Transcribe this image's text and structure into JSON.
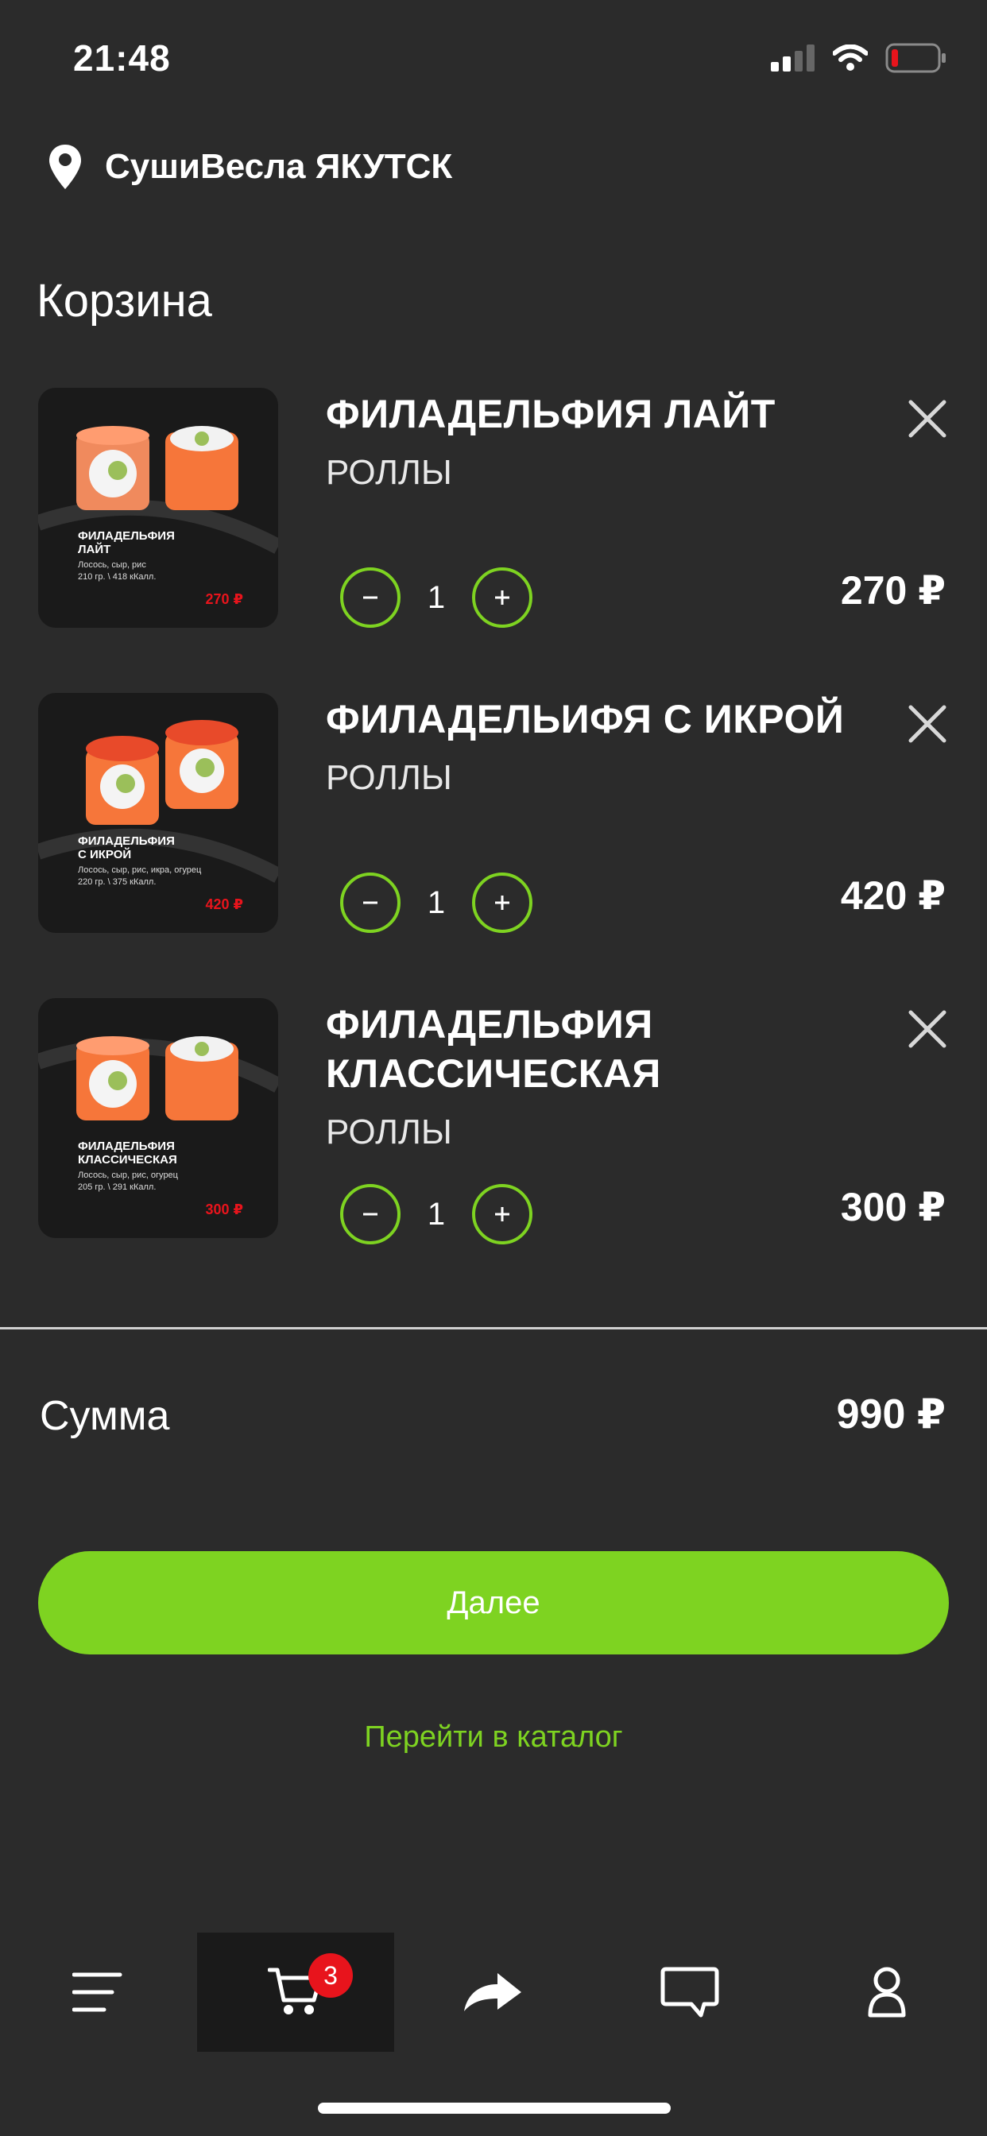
{
  "status_bar": {
    "time": "21:48"
  },
  "header": {
    "location": "СушиВесла ЯКУТСК"
  },
  "page": {
    "title": "Корзина"
  },
  "cart_items": [
    {
      "name_line1": "ФИЛАДЕЛЬФИЯ ЛАЙТ",
      "name_line2": "",
      "category": "РОЛЛЫ",
      "quantity": "1",
      "price": "270 ₽",
      "thumb": {
        "title_line1": "ФИЛАДЕЛЬФИЯ",
        "title_line2": "ЛАЙТ",
        "desc_line1": "Лосось, сыр, рис",
        "desc_line2": "210 гр. \\ 418 кКалл.",
        "price": "270 ₽"
      }
    },
    {
      "name_line1": "ФИЛАДЕЛЬИФЯ С ИКРОЙ",
      "name_line2": "",
      "category": "РОЛЛЫ",
      "quantity": "1",
      "price": "420 ₽",
      "thumb": {
        "title_line1": "ФИЛАДЕЛЬФИЯ",
        "title_line2": "С ИКРОЙ",
        "desc_line1": "Лосось, сыр, рис, икра, огурец",
        "desc_line2": "220 гр. \\ 375 кКалл.",
        "price": "420 ₽"
      }
    },
    {
      "name_line1": "ФИЛАДЕЛЬФИЯ",
      "name_line2": "КЛАССИЧЕСКАЯ",
      "category": "РОЛЛЫ",
      "quantity": "1",
      "price": "300 ₽",
      "thumb": {
        "title_line1": "ФИЛАДЕЛЬФИЯ",
        "title_line2": "КЛАССИЧЕСКАЯ",
        "desc_line1": "Лосось, сыр, рис, огурец",
        "desc_line2": "205 гр. \\ 291 кКалл.",
        "price": "300 ₽"
      }
    }
  ],
  "summary": {
    "label": "Сумма",
    "total": "990 ₽"
  },
  "actions": {
    "next_label": "Далее",
    "catalog_link": "Перейти в каталог"
  },
  "bottom_nav": {
    "cart_badge": "3",
    "active": "cart"
  },
  "colors": {
    "background": "#2b2b2b",
    "accent": "#7ed321",
    "badge": "#e8141c",
    "price_red": "#e8141c"
  },
  "icons": [
    "location-pin-icon",
    "minus-icon",
    "plus-icon",
    "close-icon",
    "menu-icon",
    "cart-icon",
    "share-icon",
    "chat-icon",
    "profile-icon"
  ]
}
